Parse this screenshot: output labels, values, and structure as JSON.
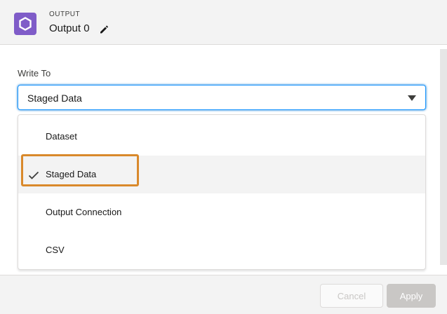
{
  "header": {
    "eyebrow": "OUTPUT",
    "title": "Output 0",
    "icon": "hexagon-icon",
    "edit_icon": "pencil-icon",
    "icon_bg_color": "#7f5cc8"
  },
  "field": {
    "label": "Write To",
    "value": "Staged Data"
  },
  "options": [
    {
      "label": "Dataset",
      "selected": false
    },
    {
      "label": "Staged Data",
      "selected": true
    },
    {
      "label": "Output Connection",
      "selected": false
    },
    {
      "label": "CSV",
      "selected": false
    }
  ],
  "footer": {
    "cancel_label": "Cancel",
    "apply_label": "Apply"
  },
  "colors": {
    "highlight": "#d9892b",
    "focus": "#1b96ff"
  }
}
